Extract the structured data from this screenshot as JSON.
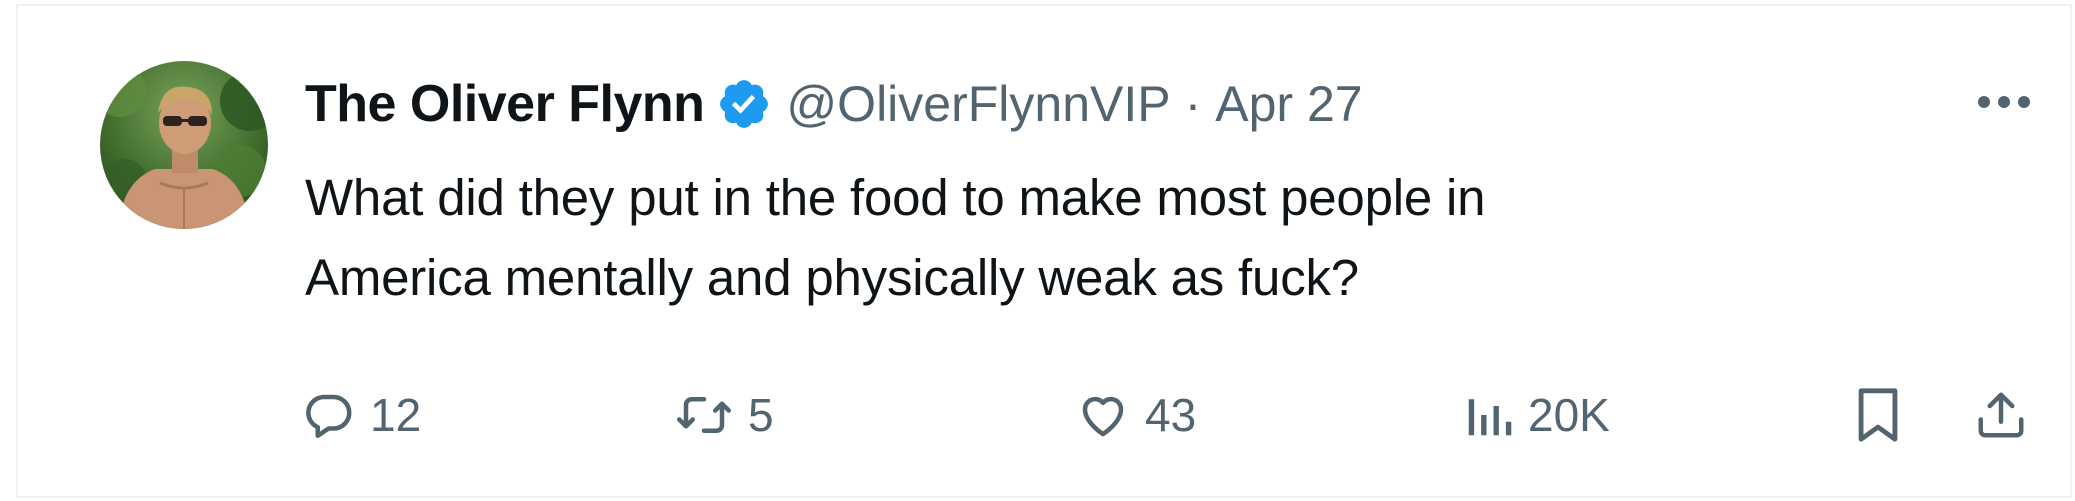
{
  "tweet": {
    "author": {
      "display_name": "The Oliver Flynn",
      "handle": "@OliverFlynnVIP",
      "verified": true
    },
    "separator": "·",
    "date": "Apr 27",
    "text_lines": [
      "What did they put in the food to make most people in",
      "America mentally and physically weak as fuck?"
    ],
    "metrics": {
      "replies": "12",
      "reposts": "5",
      "likes": "43",
      "views": "20K"
    }
  },
  "icons": {
    "more": "more-horizontal-icon",
    "reply": "speech-bubble-icon",
    "repost": "repost-arrows-icon",
    "like": "heart-icon",
    "views": "bar-chart-icon",
    "bookmark": "bookmark-icon",
    "share": "share-upload-icon"
  },
  "colors": {
    "text_primary": "#0f1419",
    "text_secondary": "#536471",
    "verified_blue": "#1d9bf0",
    "border": "#eff3f4"
  }
}
